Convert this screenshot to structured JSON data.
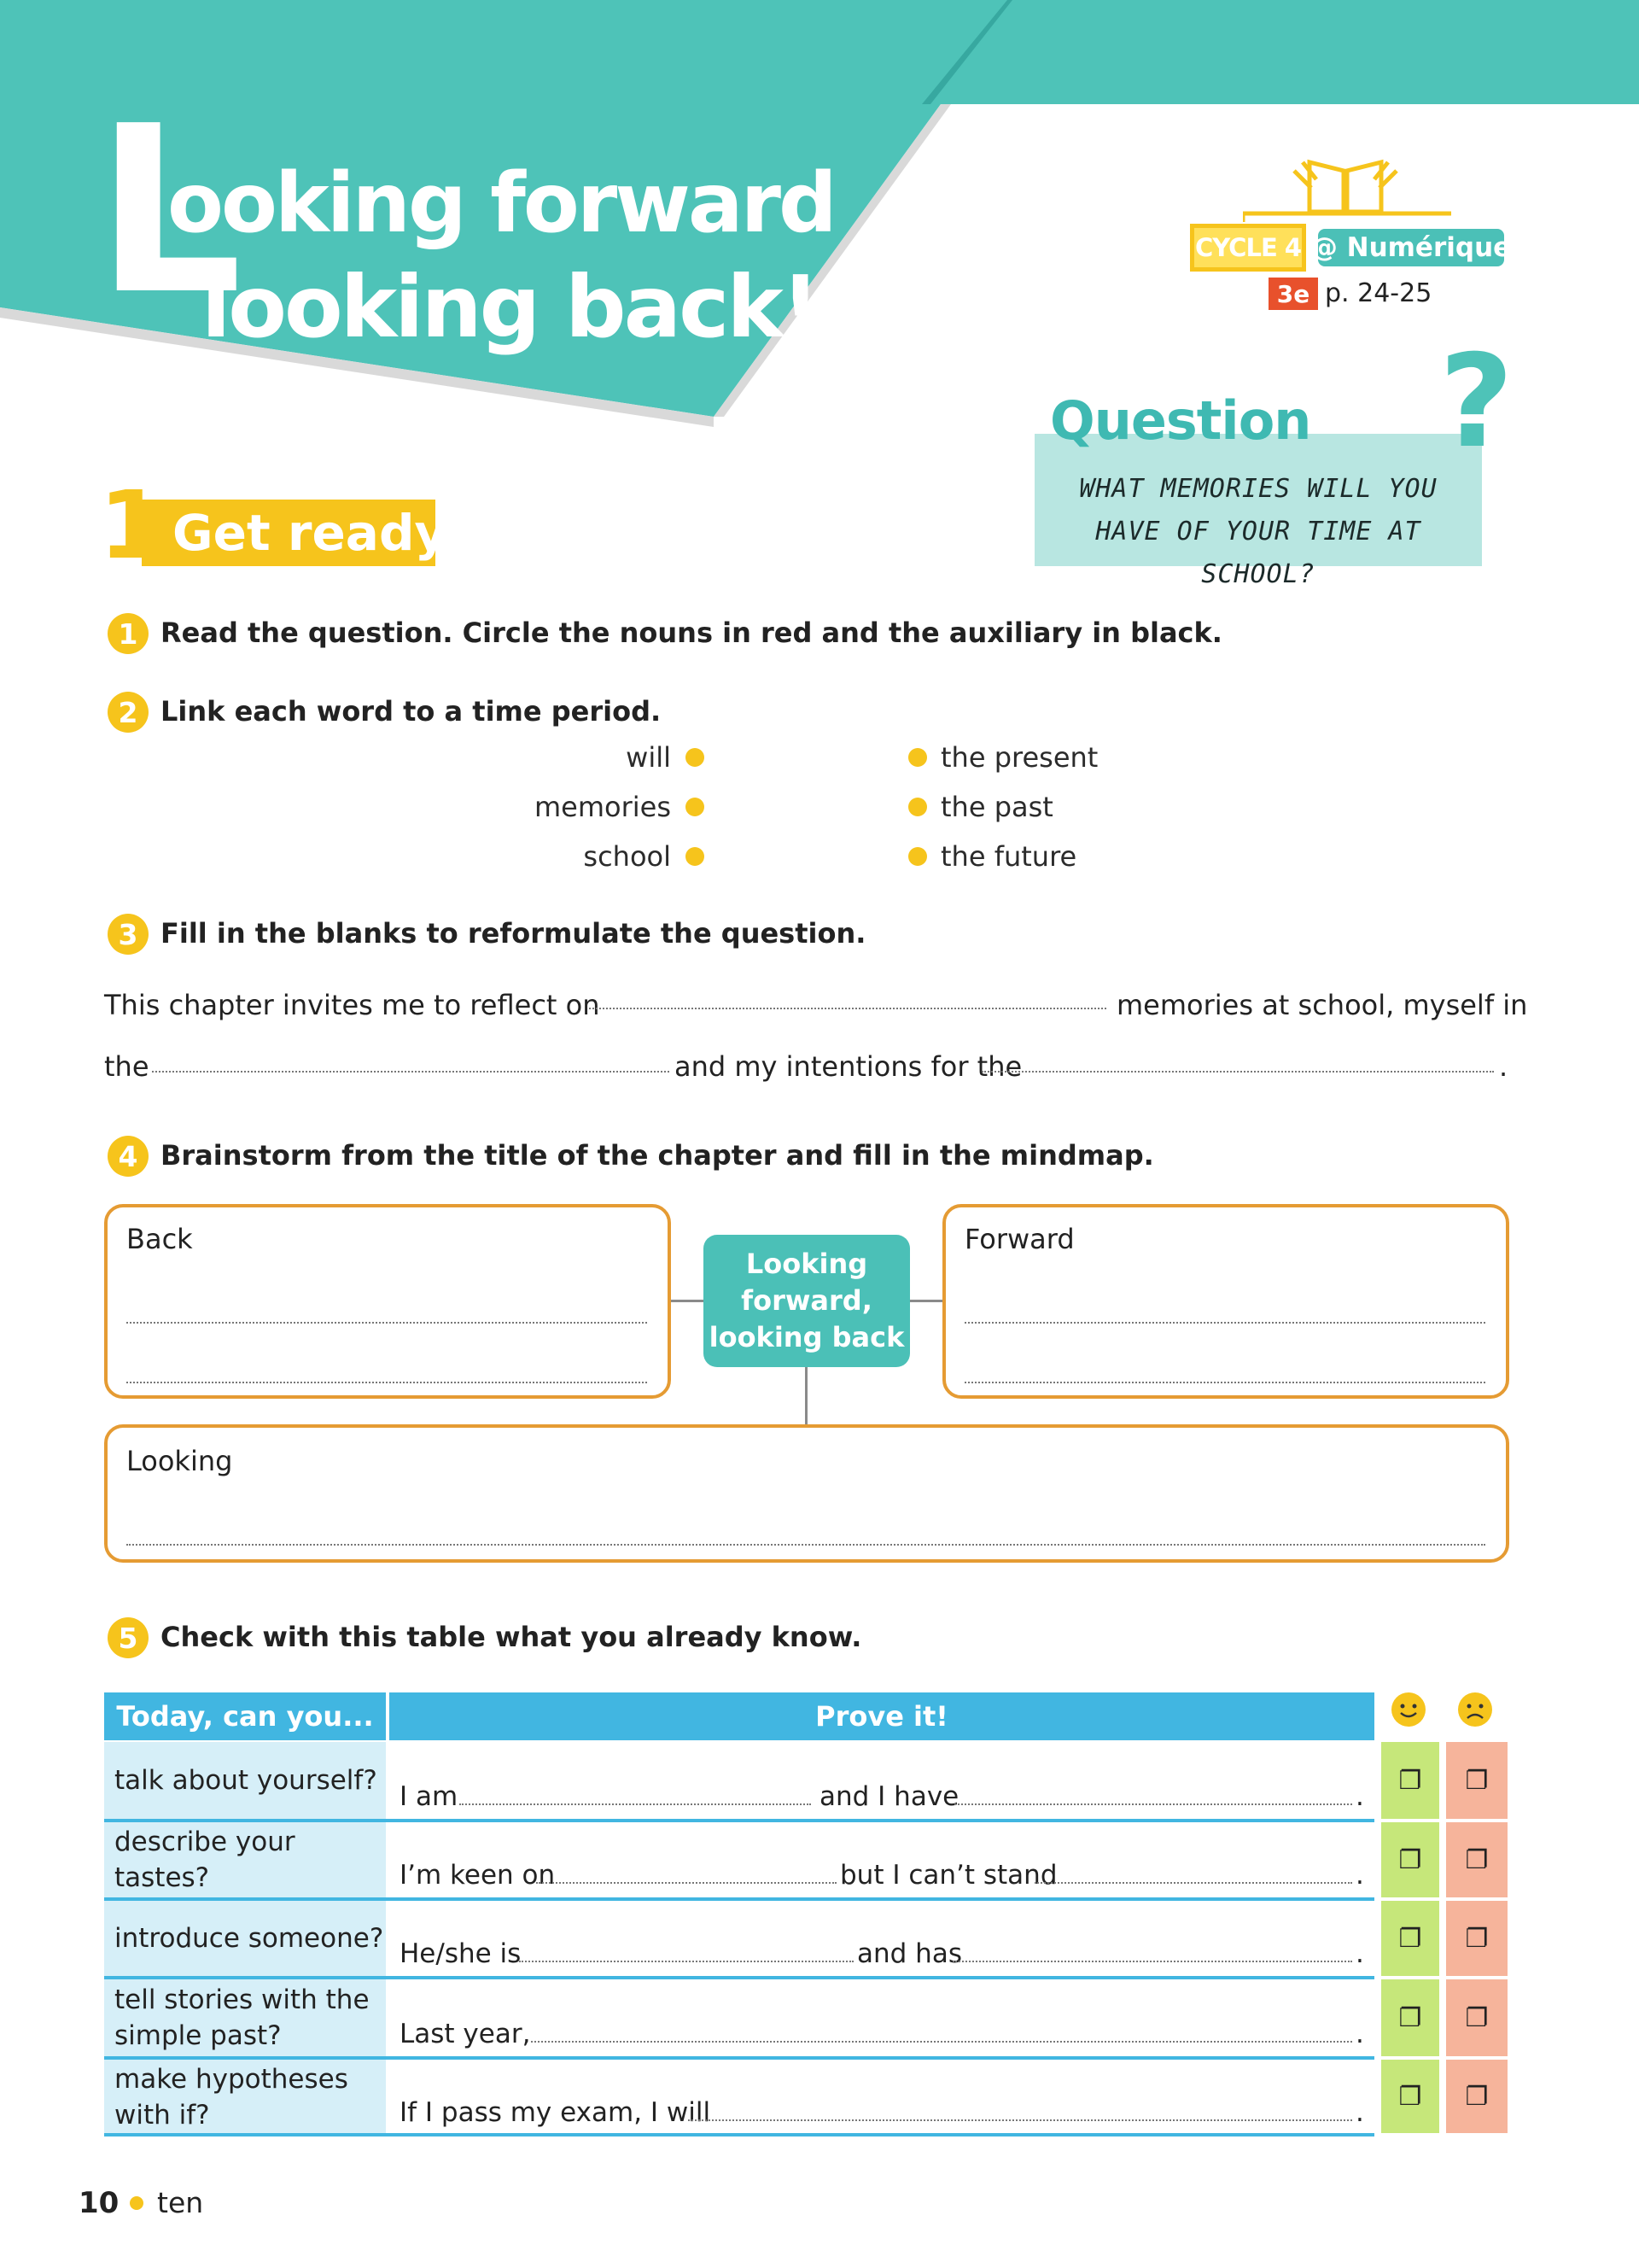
{
  "header": {
    "title_l": "L",
    "title_line1": "ooking forward",
    "title_line2": "looking back!",
    "cycle_badge": "CYCLE 4",
    "numerique_badge": "@ Numérique",
    "grade": "3e",
    "pages": "p. 24-25"
  },
  "question": {
    "title": "Question",
    "line1": "WHAT MEMORIES WILL YOU",
    "line2": "HAVE OF YOUR TIME AT SCHOOL?",
    "mark": "?"
  },
  "section": {
    "number": "1",
    "title": "Get ready"
  },
  "exercises": [
    {
      "num": "1",
      "text": "Read the question. Circle the nouns in red and the auxiliary in black."
    },
    {
      "num": "2",
      "text": "Link each word to a time period."
    },
    {
      "num": "3",
      "text": "Fill in the blanks to reformulate the question."
    },
    {
      "num": "4",
      "text": "Brainstorm from the title of the chapter and fill in the mindmap."
    },
    {
      "num": "5",
      "text": "Check with this table what you already know."
    }
  ],
  "link": {
    "left": [
      "will",
      "memories",
      "school"
    ],
    "right": [
      "the present",
      "the past",
      "the future"
    ]
  },
  "fill": {
    "part1": "This chapter invites me to reflect on",
    "part2": "memories at school, myself in",
    "part3": "the",
    "part4": "and my intentions for the",
    "part5": "."
  },
  "mindmap": {
    "back": "Back",
    "forward": "Forward",
    "center": "Looking forward, looking back",
    "looking": "Looking"
  },
  "table": {
    "header_left": "Today, can you...",
    "header_right": "Prove it!",
    "checkbox_glyph": "❐",
    "rows": [
      {
        "question": "talk about yourself?",
        "p1": "I am",
        "p2": "and I have",
        "end": "."
      },
      {
        "question": "describe your tastes?",
        "p1": "I’m keen on",
        "p2": "but I can’t stand",
        "end": "."
      },
      {
        "question": "introduce someone?",
        "p1": "He/she is",
        "p2": "and has",
        "end": "."
      },
      {
        "question": "tell stories with the simple past?",
        "p1": "Last year,",
        "p2": "",
        "end": "."
      },
      {
        "question": "make hypotheses with if?",
        "p1": "If I pass my exam, I will",
        "p2": "",
        "end": "."
      }
    ]
  },
  "footer": {
    "page_number": "10",
    "page_word": "ten"
  }
}
